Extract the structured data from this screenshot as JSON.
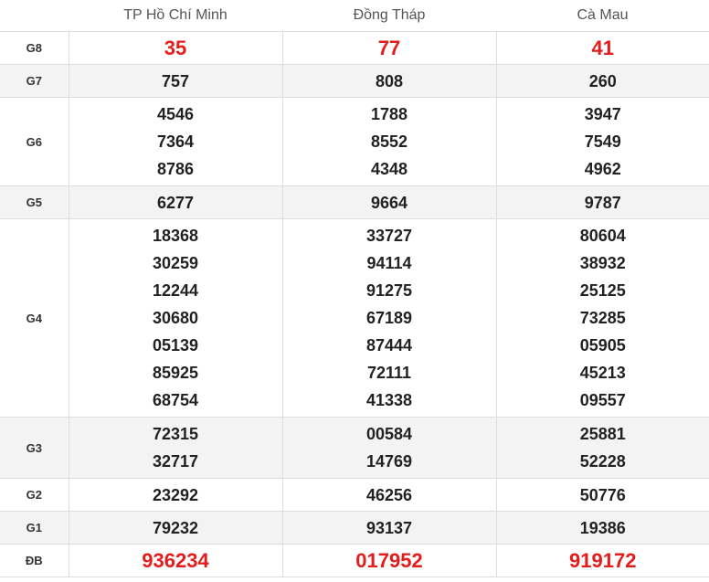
{
  "headers": [
    "",
    "TP Hồ Chí Minh",
    "Đồng Tháp",
    "Cà Mau"
  ],
  "accent_color": "#e41c1c",
  "rows": [
    {
      "label": "G8",
      "cols": [
        [
          "35"
        ],
        [
          "77"
        ],
        [
          "41"
        ]
      ]
    },
    {
      "label": "G7",
      "cols": [
        [
          "757"
        ],
        [
          "808"
        ],
        [
          "260"
        ]
      ]
    },
    {
      "label": "G6",
      "cols": [
        [
          "4546",
          "7364",
          "8786"
        ],
        [
          "1788",
          "8552",
          "4348"
        ],
        [
          "3947",
          "7549",
          "4962"
        ]
      ]
    },
    {
      "label": "G5",
      "cols": [
        [
          "6277"
        ],
        [
          "9664"
        ],
        [
          "9787"
        ]
      ]
    },
    {
      "label": "G4",
      "cols": [
        [
          "18368",
          "30259",
          "12244",
          "30680",
          "05139",
          "85925",
          "68754"
        ],
        [
          "33727",
          "94114",
          "91275",
          "67189",
          "87444",
          "72111",
          "41338"
        ],
        [
          "80604",
          "38932",
          "25125",
          "73285",
          "05905",
          "45213",
          "09557"
        ]
      ]
    },
    {
      "label": "G3",
      "cols": [
        [
          "72315",
          "32717"
        ],
        [
          "00584",
          "14769"
        ],
        [
          "25881",
          "52228"
        ]
      ]
    },
    {
      "label": "G2",
      "cols": [
        [
          "23292"
        ],
        [
          "46256"
        ],
        [
          "50776"
        ]
      ]
    },
    {
      "label": "G1",
      "cols": [
        [
          "79232"
        ],
        [
          "93137"
        ],
        [
          "19386"
        ]
      ]
    },
    {
      "label": "ĐB",
      "cols": [
        [
          "936234"
        ],
        [
          "017952"
        ],
        [
          "919172"
        ]
      ]
    }
  ]
}
